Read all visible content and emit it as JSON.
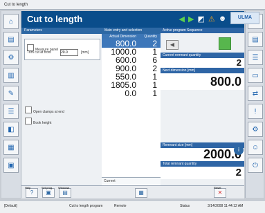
{
  "window_title": "Cut to length",
  "header": {
    "title": "Cut to length",
    "brand": "ULMA"
  },
  "params": {
    "title": "Parameters",
    "check1": "Measure panel",
    "trim_label": "Trim cut at front",
    "trim_value": "20.0",
    "trim_unit": "[mm]",
    "open_clamps": "Open clamps at end",
    "book_height": "Book height"
  },
  "table": {
    "title": "Main entry and selection",
    "col_dim": "Actual Dimension",
    "col_qty": "Quantity",
    "rows": [
      {
        "dim": "800.0",
        "qty": "2"
      },
      {
        "dim": "1000.0",
        "qty": "1"
      },
      {
        "dim": "600.0",
        "qty": "6"
      },
      {
        "dim": "900.0",
        "qty": "2"
      },
      {
        "dim": "550.0",
        "qty": "1"
      },
      {
        "dim": "1805.0",
        "qty": "1"
      },
      {
        "dim": "0.0",
        "qty": "1"
      }
    ],
    "current_label": "Current"
  },
  "status": {
    "program_label": "Active program Sequence",
    "current_quantity_label": "Current remnant quantity",
    "current_quantity": "2",
    "next_dimension_label": "Next dimension [mm]",
    "next_dimension": "800.0",
    "remnant_label": "Remnant size [mm]",
    "remnant": "2000.0",
    "total_remnant_label": "Total remnant quantity",
    "total_remnant": "2"
  },
  "bottom": {
    "help": "Help",
    "set_prog": "Set prog.",
    "windows": "Windows",
    "reset": "Reset"
  },
  "statusbar": {
    "left": "[Default]",
    "program": "Cut to length program",
    "remote": "Remote",
    "state": "Status",
    "date": "3/14/2008 11:44:12 AM"
  }
}
